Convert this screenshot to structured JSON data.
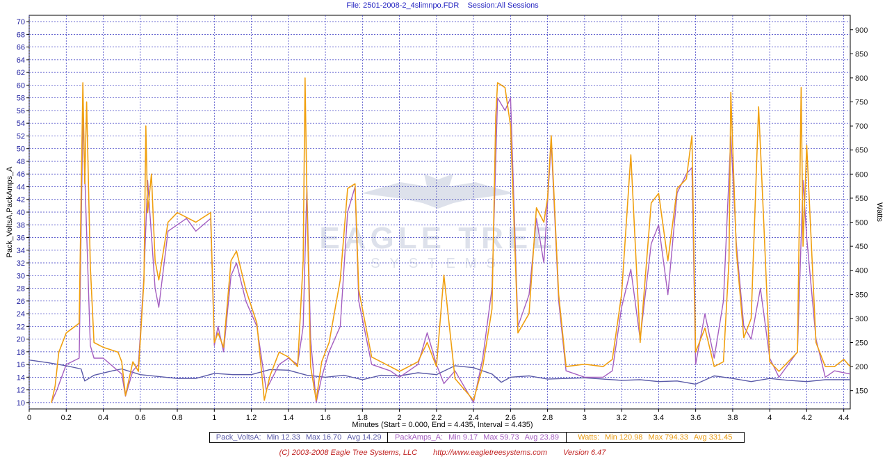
{
  "title": {
    "file_label": "File: 2501-2008-2_4slimnpo.FDR",
    "session_label": "Session:All Sessions"
  },
  "footer": {
    "copyright": "(C) 2003-2008 Eagle Tree Systems, LLC",
    "url": "http://www.eagletreesystems.com",
    "version": "Version 6.47"
  },
  "watermark": "EAGLE TREE SYSTEMS",
  "legend": [
    {
      "name": "Pack_VoltsA:",
      "min": "Min 12.33",
      "max": "Max 16.70",
      "avg": "Avg 14.29",
      "color": "#5a5aa8"
    },
    {
      "name": "PackAmps_A:",
      "min": "Min 9.17",
      "max": "Max 59.73",
      "avg": "Avg 23.89",
      "color": "#a45ec0"
    },
    {
      "name": "Watts:",
      "min": "Min 120.98",
      "max": "Max 794.33",
      "avg": "Avg 331.45",
      "color": "#f0a010"
    }
  ],
  "chart_data": {
    "type": "line",
    "title": "File: 2501-2008-2_4slimnpo.FDR   Session:All Sessions",
    "xlabel": "Minutes (Start = 0.000,  End = 4.435,  Interval =  4.435)",
    "ylabel": "Pack_VoltsA,PackAmps_A",
    "y2label": "Watts",
    "xlim": [
      0,
      4.435
    ],
    "ylim": [
      9,
      71
    ],
    "y2lim": [
      112,
      930
    ],
    "x_ticks": [
      0,
      0.2,
      0.4,
      0.6,
      0.8,
      1,
      1.2,
      1.4,
      1.6,
      1.8,
      2,
      2.2,
      2.4,
      2.6,
      2.8,
      3,
      3.2,
      3.4,
      3.6,
      3.8,
      4,
      4.2,
      4.4
    ],
    "x_tick_labels": [
      "0",
      "0.2",
      "0.4",
      "0.6",
      "0.8",
      "1",
      "1.2",
      "1.4",
      "1.6",
      "1.8",
      "2",
      "2.2",
      "2.4",
      "2.6",
      "2.8",
      "3",
      "3.2",
      "3.4",
      "3.6",
      "3.8",
      "4",
      "4.2",
      "4.4"
    ],
    "y_ticks": [
      10,
      12,
      14,
      16,
      18,
      20,
      22,
      24,
      26,
      28,
      30,
      32,
      34,
      36,
      38,
      40,
      42,
      44,
      46,
      48,
      50,
      52,
      54,
      56,
      58,
      60,
      62,
      64,
      66,
      68,
      70
    ],
    "y2_ticks": [
      150,
      200,
      250,
      300,
      350,
      400,
      450,
      500,
      550,
      600,
      650,
      700,
      750,
      800,
      850,
      900
    ],
    "grid": true,
    "legend_position": "bottom",
    "series": [
      {
        "name": "Pack_VoltsA",
        "axis": "left",
        "color": "#5a5aa8",
        "x": [
          0,
          0.1,
          0.2,
          0.28,
          0.3,
          0.35,
          0.45,
          0.5,
          0.6,
          0.7,
          0.8,
          0.9,
          1.0,
          1.1,
          1.2,
          1.3,
          1.4,
          1.5,
          1.6,
          1.7,
          1.8,
          1.9,
          2.0,
          2.1,
          2.2,
          2.3,
          2.4,
          2.5,
          2.55,
          2.6,
          2.7,
          2.8,
          2.9,
          3.0,
          3.1,
          3.2,
          3.3,
          3.4,
          3.5,
          3.6,
          3.7,
          3.8,
          3.9,
          4.0,
          4.1,
          4.2,
          4.3,
          4.435
        ],
        "y": [
          16.7,
          16.3,
          15.8,
          15.3,
          13.4,
          14.3,
          15.0,
          15.3,
          14.4,
          14.1,
          13.8,
          13.8,
          14.6,
          14.4,
          14.4,
          15.2,
          15.1,
          14.3,
          14.0,
          14.3,
          13.6,
          14.3,
          14.2,
          14.7,
          14.4,
          15.8,
          15.5,
          14.5,
          13.2,
          14.0,
          14.2,
          13.7,
          13.8,
          13.9,
          13.7,
          13.5,
          13.6,
          13.3,
          13.4,
          12.9,
          14.2,
          13.8,
          13.3,
          13.8,
          13.5,
          13.3,
          13.6,
          13.6
        ]
      },
      {
        "name": "PackAmps_A",
        "axis": "left",
        "color": "#a45ec0",
        "x": [
          0.12,
          0.15,
          0.2,
          0.27,
          0.29,
          0.3,
          0.33,
          0.35,
          0.4,
          0.5,
          0.52,
          0.56,
          0.59,
          0.62,
          0.64,
          0.68,
          0.7,
          0.75,
          0.8,
          0.85,
          0.9,
          0.98,
          1.0,
          1.02,
          1.05,
          1.09,
          1.12,
          1.17,
          1.23,
          1.28,
          1.35,
          1.4,
          1.45,
          1.48,
          1.5,
          1.52,
          1.55,
          1.58,
          1.62,
          1.68,
          1.72,
          1.76,
          1.78,
          1.85,
          1.95,
          2.0,
          2.1,
          2.15,
          2.2,
          2.24,
          2.3,
          2.4,
          2.45,
          2.5,
          2.53,
          2.57,
          2.6,
          2.64,
          2.7,
          2.74,
          2.78,
          2.82,
          2.86,
          2.9,
          3.0,
          3.1,
          3.15,
          3.2,
          3.25,
          3.3,
          3.36,
          3.4,
          3.45,
          3.5,
          3.55,
          3.58,
          3.6,
          3.65,
          3.7,
          3.75,
          3.79,
          3.82,
          3.86,
          3.9,
          3.95,
          4.0,
          4.05,
          4.1,
          4.15,
          4.18,
          4.2,
          4.25,
          4.3,
          4.35,
          4.435
        ],
        "y": [
          10,
          12,
          16,
          17,
          55,
          46,
          19,
          17,
          17,
          14.5,
          11,
          15,
          16,
          30,
          45,
          28,
          25,
          37,
          38,
          39,
          37,
          39,
          19,
          22,
          18,
          30,
          32,
          26,
          22,
          12,
          16,
          17,
          16,
          22,
          44,
          20,
          10,
          14,
          18,
          22,
          40,
          44,
          26,
          16,
          15,
          14,
          16,
          21,
          16,
          13,
          15,
          10,
          17,
          28,
          58,
          56,
          58,
          22,
          27,
          39,
          32,
          51,
          26,
          15,
          14,
          14,
          15,
          25,
          31,
          20,
          35,
          38,
          27,
          43,
          46,
          47,
          16,
          24,
          17,
          26,
          52,
          35,
          22,
          20,
          28,
          17,
          14,
          16,
          18,
          45,
          36,
          20,
          14,
          15,
          14.5
        ]
      },
      {
        "name": "Watts",
        "axis": "right",
        "color": "#f0a010",
        "x": [
          0.12,
          0.14,
          0.16,
          0.2,
          0.27,
          0.29,
          0.3,
          0.31,
          0.33,
          0.35,
          0.4,
          0.48,
          0.5,
          0.52,
          0.56,
          0.59,
          0.62,
          0.63,
          0.64,
          0.66,
          0.68,
          0.7,
          0.75,
          0.8,
          0.85,
          0.9,
          0.98,
          1.0,
          1.02,
          1.05,
          1.09,
          1.12,
          1.17,
          1.23,
          1.27,
          1.3,
          1.35,
          1.4,
          1.45,
          1.48,
          1.49,
          1.5,
          1.52,
          1.55,
          1.58,
          1.62,
          1.68,
          1.72,
          1.76,
          1.78,
          1.85,
          1.95,
          2.0,
          2.1,
          2.15,
          2.2,
          2.24,
          2.3,
          2.4,
          2.45,
          2.5,
          2.52,
          2.53,
          2.57,
          2.6,
          2.64,
          2.7,
          2.74,
          2.78,
          2.8,
          2.82,
          2.86,
          2.9,
          3.0,
          3.1,
          3.15,
          3.2,
          3.25,
          3.3,
          3.36,
          3.4,
          3.45,
          3.5,
          3.55,
          3.58,
          3.6,
          3.65,
          3.7,
          3.75,
          3.78,
          3.79,
          3.82,
          3.86,
          3.9,
          3.94,
          3.97,
          4.0,
          4.05,
          4.1,
          4.15,
          4.17,
          4.18,
          4.2,
          4.25,
          4.3,
          4.35,
          4.4,
          4.435
        ],
        "y": [
          125,
          160,
          230,
          270,
          290,
          790,
          580,
          750,
          410,
          250,
          240,
          230,
          210,
          140,
          210,
          190,
          380,
          700,
          520,
          600,
          420,
          380,
          500,
          520,
          510,
          500,
          520,
          250,
          270,
          240,
          420,
          440,
          360,
          290,
          130,
          180,
          230,
          220,
          200,
          420,
          800,
          560,
          200,
          130,
          210,
          250,
          380,
          570,
          580,
          360,
          220,
          200,
          190,
          210,
          250,
          200,
          390,
          175,
          130,
          200,
          320,
          720,
          790,
          780,
          700,
          270,
          310,
          530,
          500,
          550,
          680,
          350,
          200,
          205,
          200,
          215,
          350,
          640,
          250,
          540,
          560,
          420,
          570,
          590,
          680,
          230,
          280,
          200,
          210,
          420,
          770,
          440,
          260,
          300,
          740,
          480,
          210,
          190,
          210,
          230,
          780,
          450,
          660,
          250,
          200,
          200,
          215,
          200
        ]
      }
    ]
  }
}
